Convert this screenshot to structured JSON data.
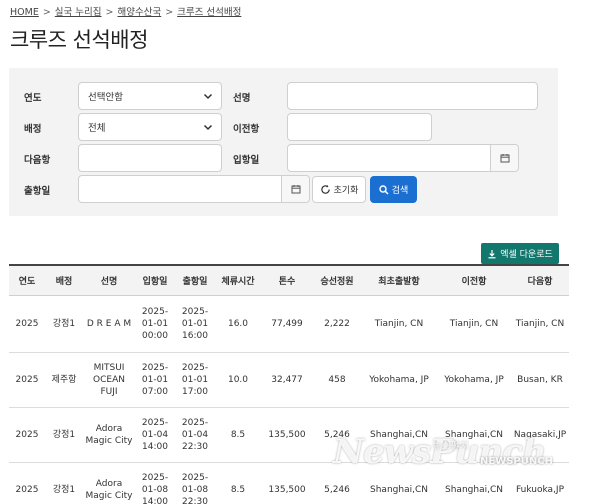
{
  "breadcrumb": [
    "HOME",
    "실국 누리집",
    "해양수산국",
    "크루즈 선석배정"
  ],
  "page_title": "크루즈 선석배정",
  "search": {
    "year_label": "연도",
    "year_value": "선택안함",
    "ship_label": "선명",
    "ship_value": "",
    "berth_label": "배정",
    "berth_value": "전체",
    "prev_port_label": "이전항",
    "prev_port_value": "",
    "next_port_label": "다음항",
    "next_port_value": "",
    "arrival_label": "입항일",
    "arrival_value": "",
    "departure_label": "출항일",
    "departure_value": "",
    "reset_label": "초기화",
    "search_label": "검색"
  },
  "excel_label": "엑셀 다운로드",
  "table": {
    "headers": [
      "연도",
      "배정",
      "선명",
      "입항일",
      "출항일",
      "체류시간",
      "톤수",
      "승선정원",
      "최초출발항",
      "이전항",
      "다음항"
    ],
    "rows": [
      [
        "2025",
        "강정1",
        "D R E A M",
        "2025-01-01 00:00",
        "2025-01-01 16:00",
        "16.0",
        "77,499",
        "2,222",
        "Tianjin, CN",
        "Tianjin, CN",
        "Tianjin, CN"
      ],
      [
        "2025",
        "제주항",
        "MITSUI OCEAN FUJI",
        "2025-01-01 07:00",
        "2025-01-01 17:00",
        "10.0",
        "32,477",
        "458",
        "Yokohama, JP",
        "Yokohama, JP",
        "Busan, KR"
      ],
      [
        "2025",
        "강정1",
        "Adora Magic City",
        "2025-01-04 14:00",
        "2025-01-04 22:30",
        "8.5",
        "135,500",
        "5,246",
        "Shanghai,CN",
        "Shanghai,CN",
        "Nagasaki,JP"
      ],
      [
        "2025",
        "강정1",
        "Adora Magic City",
        "2025-01-08 14:00",
        "2025-01-08 22:30",
        "8.5",
        "135,500",
        "5,246",
        "Shanghai,CN",
        "Shanghai,CN",
        "Fukuoka,JP"
      ]
    ]
  },
  "watermark": {
    "main": "NewsPunch",
    "han": "뉴스펀치",
    "small": "NEWSPUNCH"
  },
  "colors": {
    "search_button": "#1a6fd1",
    "excel_button": "#12786e",
    "panel_bg": "#f3f3f3"
  }
}
